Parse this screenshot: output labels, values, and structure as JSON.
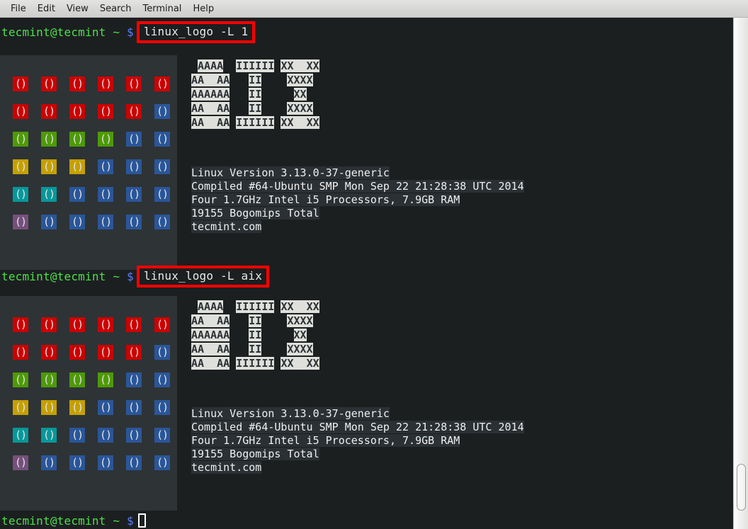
{
  "window": {
    "menu": [
      "File",
      "Edit",
      "View",
      "Search",
      "Terminal",
      "Help"
    ]
  },
  "theme": {
    "terminal_bg": "#1c1f20",
    "panel_bg": "#2e3336",
    "prompt_green": "#4ce04c",
    "dollar_blue": "#5c7cfa",
    "highlight_red": "#ff0000",
    "art_fg": "#dfe0db",
    "info_fg": "#efefef"
  },
  "prompts": {
    "user_host": "tecmint@tecmint",
    "path": "~",
    "symbol": "$"
  },
  "commands": {
    "first": "linux_logo -L 1",
    "second": "linux_logo -L aix",
    "third": ""
  },
  "ascii_art": {
    "name": "aix-logo",
    "lines": [
      " AAAA  IIIIII XX  XX ",
      "AA  AA   II    XXXX  ",
      "AAAAAA   II     XX   ",
      "AA  AA   II    XXXX  ",
      "AA  AA IIIIII XX  XX "
    ]
  },
  "sysinfo": {
    "lines": [
      "Linux Version 3.13.0-37-generic",
      "Compiled #64-Ubuntu SMP Mon Sep 22 21:28:38 UTC 2014",
      "Four 1.7GHz Intel i5 Processors, 7.9GB RAM",
      "19155 Bogomips Total",
      "tecmint.com"
    ]
  },
  "color_grid": {
    "glyph": "()",
    "rows": [
      [
        "#cc0000",
        "#cc0000",
        "#cc0000",
        "#cc0000",
        "#cc0000",
        "#cc0000"
      ],
      [
        "#cc0000",
        "#cc0000",
        "#cc0000",
        "#cc0000",
        "#cc0000",
        "#2a5699"
      ],
      [
        "#4e9a06",
        "#4e9a06",
        "#4e9a06",
        "#4e9a06",
        "#2a5699",
        "#2a5699"
      ],
      [
        "#c4a000",
        "#c4a000",
        "#c4a000",
        "#2a5699",
        "#2a5699",
        "#2a5699"
      ],
      [
        "#06989a",
        "#06989a",
        "#2a5699",
        "#2a5699",
        "#2a5699",
        "#2a5699"
      ],
      [
        "#75507b",
        "#2a5699",
        "#2a5699",
        "#2a5699",
        "#2a5699",
        "#2a5699"
      ]
    ]
  },
  "scrollbar": {
    "position_label": "bottom"
  }
}
